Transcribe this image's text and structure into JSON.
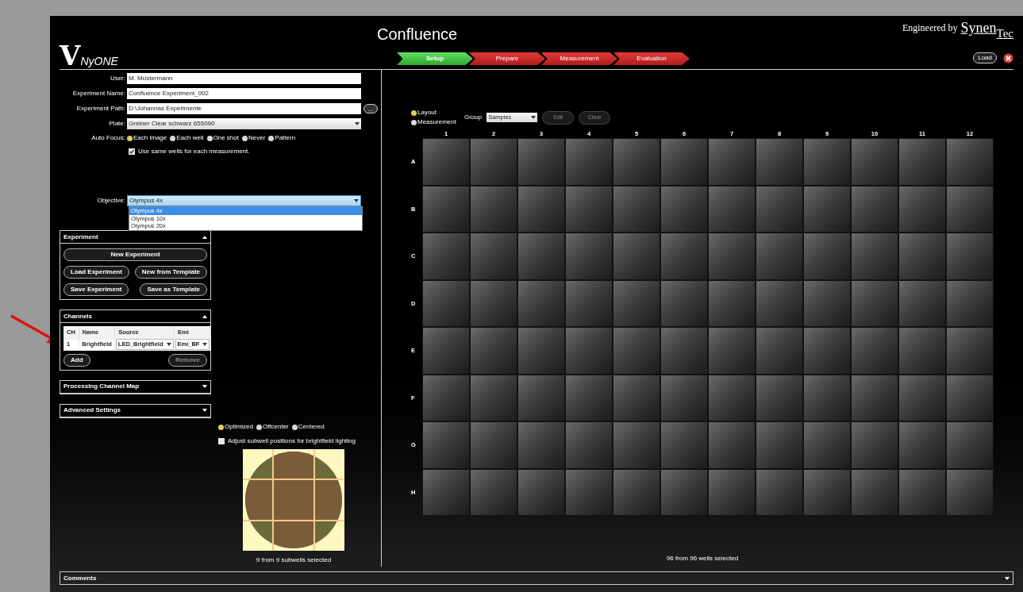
{
  "logo": {
    "mark": "V",
    "text": "NyONE"
  },
  "title": "Confluence",
  "brand": {
    "prefix": "Engineered by",
    "parts": [
      "Synen",
      "Tec"
    ]
  },
  "steps": [
    {
      "label": "Setup",
      "selected": true
    },
    {
      "label": "Prepare",
      "selected": false
    },
    {
      "label": "Measurement",
      "selected": false
    },
    {
      "label": "Evaluation",
      "selected": false
    }
  ],
  "header_buttons": {
    "load": "Load"
  },
  "form": {
    "fields": [
      {
        "kind": "text",
        "label": "User:",
        "value": "M. Mustermann"
      },
      {
        "kind": "text",
        "label": "Experiment Name:",
        "value": "Confluence Experiment_002"
      },
      {
        "kind": "path",
        "label": "Experiment Path:",
        "value": "D:\\Johannas Experimente",
        "browse": "..."
      },
      {
        "kind": "select",
        "label": "Plate:",
        "value": "Greiner Clear schwarz 655090"
      }
    ],
    "auto_focus": {
      "label": "Auto Focus:",
      "options": [
        {
          "label": "Each image",
          "selected": true
        },
        {
          "label": "Each well",
          "selected": false
        },
        {
          "label": "One shot",
          "selected": false
        },
        {
          "label": "Never",
          "selected": false
        },
        {
          "label": "Pattern",
          "selected": false
        }
      ]
    },
    "same_wells": {
      "label": "Use same wells for each measurement.",
      "checked": true
    },
    "objective": {
      "label": "Objective:",
      "value": "Olympus 4x",
      "expanded": true,
      "options": [
        {
          "label": "Olympus 4x",
          "selected": true
        },
        {
          "label": "Olympus 10x",
          "selected": false
        },
        {
          "label": "Olympus 20x",
          "selected": false
        }
      ]
    }
  },
  "panels": [
    {
      "kind": "experiment",
      "title": "Experiment",
      "expanded": true,
      "buttons": [
        {
          "label": "New Experiment",
          "disabled": false
        },
        {
          "label": "Load Experiment",
          "disabled": false
        },
        {
          "label": "New from Template",
          "disabled": false
        },
        {
          "label": "Save Experiment",
          "disabled": false
        },
        {
          "label": "Save as Template",
          "disabled": false
        }
      ]
    },
    {
      "kind": "channels",
      "title": "Channels",
      "expanded": true,
      "columns": [
        "CH",
        "Name",
        "Source",
        "Emi"
      ],
      "rows": [
        [
          "1",
          "Brightfield",
          "LED_Brightfield",
          "Emi_BF"
        ]
      ],
      "buttons": [
        {
          "label": "Add",
          "disabled": false
        },
        {
          "label": "Remove",
          "disabled": true
        }
      ]
    },
    {
      "kind": "plain",
      "title": "Processing Channel Map",
      "expanded": false
    },
    {
      "kind": "plain",
      "title": "Advanced Settings",
      "expanded": false
    }
  ],
  "subwells": {
    "options": [
      {
        "label": "Optimized",
        "selected": true
      },
      {
        "label": "Offcenter",
        "selected": false
      },
      {
        "label": "Centered",
        "selected": false
      }
    ],
    "adjust": {
      "label": "Adjust subwell positions for brightfield lighting",
      "checked": false
    },
    "status": "9 from 9 subwells selected"
  },
  "plate": {
    "mode": [
      {
        "label": "Layout",
        "selected": true
      },
      {
        "label": "Measurement",
        "selected": false
      }
    ],
    "group": {
      "label": "Group",
      "value": "Samples"
    },
    "buttons": [
      {
        "label": "Edit",
        "disabled": true
      },
      {
        "label": "Clear",
        "disabled": true
      }
    ],
    "columns": [
      "1",
      "2",
      "3",
      "4",
      "5",
      "6",
      "7",
      "8",
      "9",
      "10",
      "11",
      "12"
    ],
    "rows": [
      "A",
      "B",
      "C",
      "D",
      "E",
      "F",
      "G",
      "H"
    ],
    "status": "96 from 96 wells selected"
  },
  "comments": {
    "title": "Comments",
    "expanded": false
  }
}
